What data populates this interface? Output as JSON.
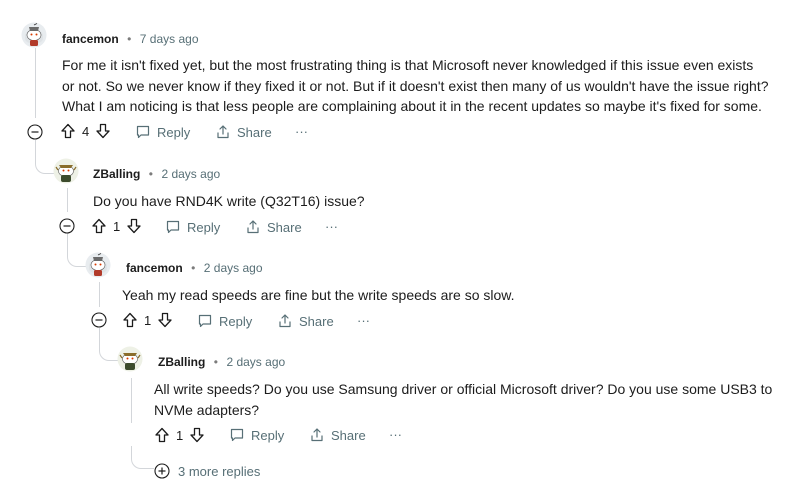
{
  "comments": [
    {
      "author": "fancemon",
      "separator": "•",
      "time": "7 days ago",
      "lines": [
        "For me it isn't fixed yet, but the most frustrating thing is that Microsoft never knowledged if this issue even exists",
        "or not. So we never know if they fixed it or not. But if it doesn't exist then many of us wouldn't have the issue right?",
        "What I am noticing is that less people are complaining about it in the recent updates so maybe it's fixed for some."
      ],
      "votes": "4",
      "reply_label": "Reply",
      "share_label": "Share",
      "more_label": "···"
    },
    {
      "author": "ZBalling",
      "separator": "•",
      "time": "2 days ago",
      "lines": [
        "Do you have RND4K write (Q32T16) issue?"
      ],
      "votes": "1",
      "reply_label": "Reply",
      "share_label": "Share",
      "more_label": "···"
    },
    {
      "author": "fancemon",
      "separator": "•",
      "time": "2 days ago",
      "lines": [
        "Yeah my read speeds are fine but the write speeds are so slow."
      ],
      "votes": "1",
      "reply_label": "Reply",
      "share_label": "Share",
      "more_label": "···"
    },
    {
      "author": "ZBalling",
      "separator": "•",
      "time": "2 days ago",
      "lines": [
        "All write speeds? Do you use Samsung driver or official Microsoft driver? Do you use some USB3 to",
        "NVMe adapters?"
      ],
      "votes": "1",
      "reply_label": "Reply",
      "share_label": "Share",
      "more_label": "···"
    }
  ],
  "more_replies_label": "3 more replies",
  "colors": {
    "meta": "#576f76",
    "line": "#d3d6da",
    "text": "#1c1c1c"
  }
}
